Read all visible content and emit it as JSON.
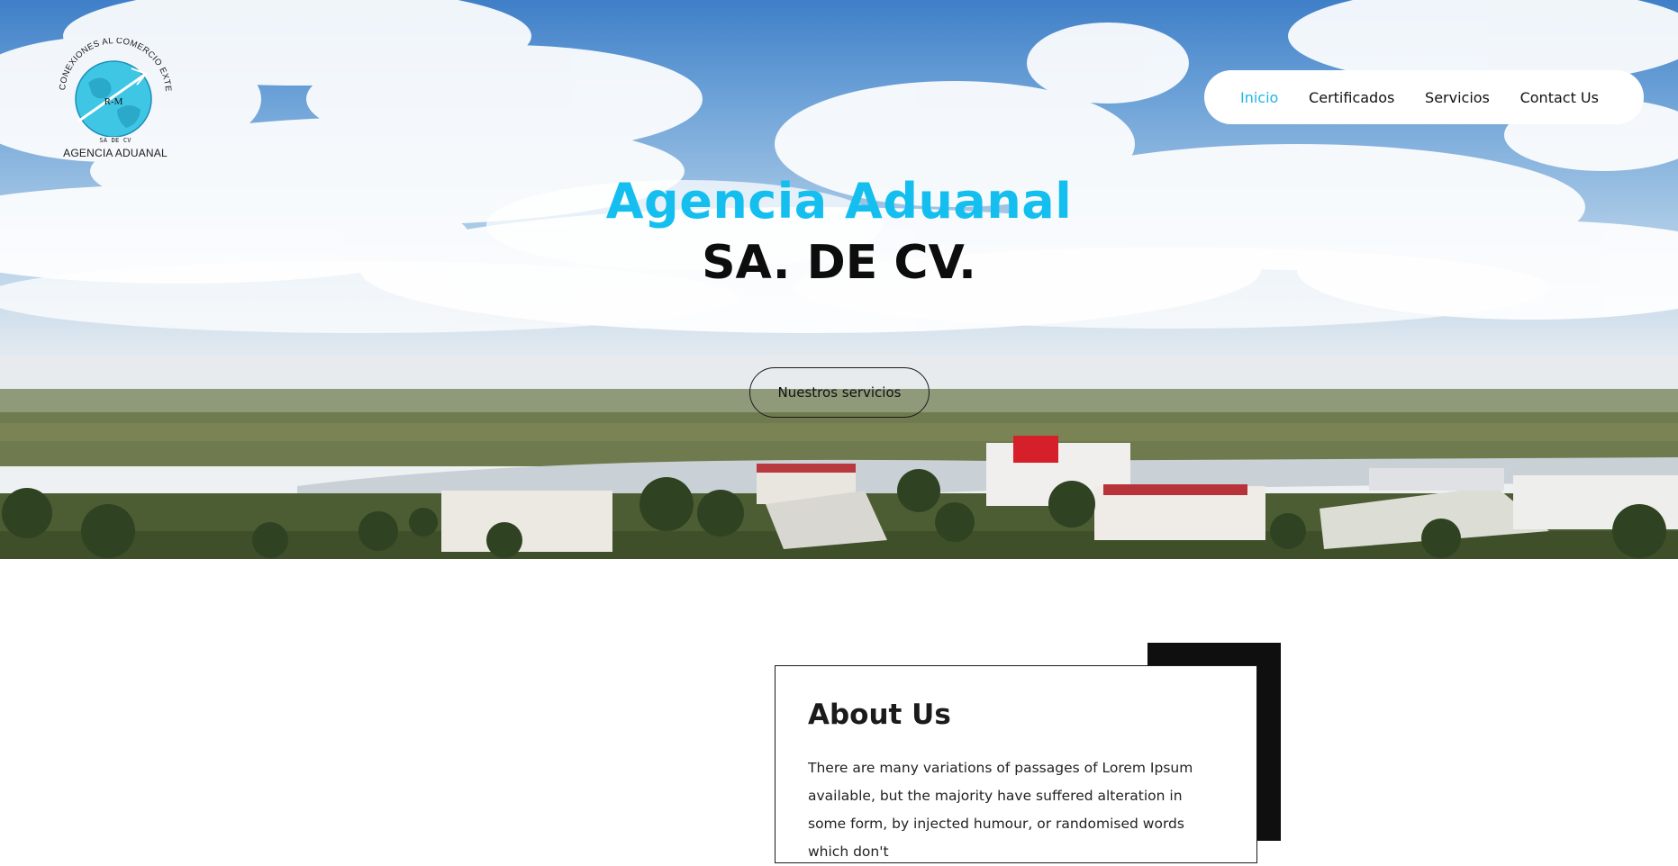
{
  "logo": {
    "arc_text": "CONEXIONES AL COMERCIO EXTERIOR",
    "monogram": "R-M",
    "sub": "SA DE CV",
    "name": "AGENCIA ADUANAL"
  },
  "nav": {
    "items": [
      {
        "label": "Inicio",
        "active": true
      },
      {
        "label": "Certificados",
        "active": false
      },
      {
        "label": "Servicios",
        "active": false
      },
      {
        "label": "Contact Us",
        "active": false
      }
    ]
  },
  "hero": {
    "title_line1": "Agencia Aduanal",
    "title_line2": "SA. DE CV.",
    "cta_label": "Nuestros servicios"
  },
  "about": {
    "title": "About Us",
    "body": "There are many variations of passages of Lorem Ipsum available, but the majority have suffered alteration in some form, by injected humour, or randomised words which don't"
  },
  "colors": {
    "accent": "#14bff0",
    "nav_active": "#1fb6e9",
    "dark": "#0f0f0f"
  }
}
